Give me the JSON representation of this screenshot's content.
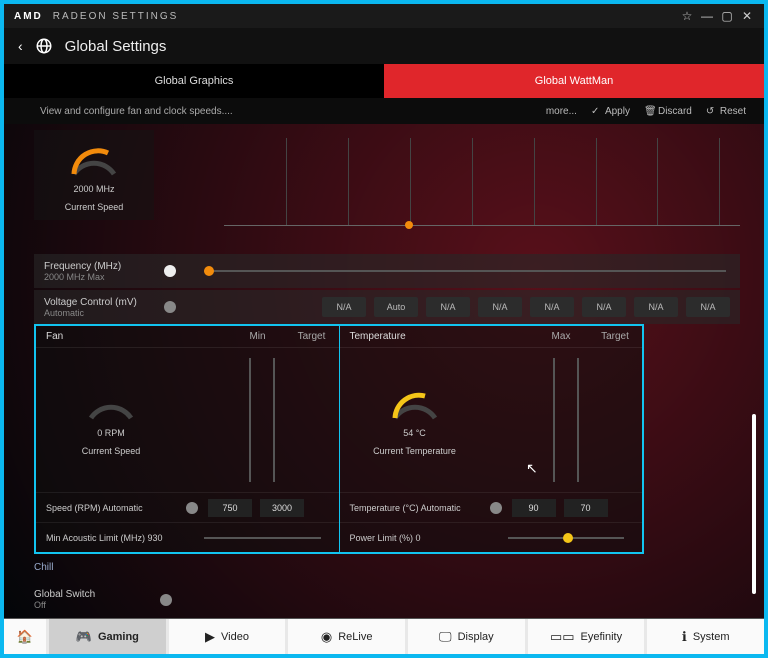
{
  "titlebar": {
    "brand": "AMD",
    "title": "RADEON SETTINGS"
  },
  "header": {
    "title": "Global Settings"
  },
  "tabs": {
    "graphics": "Global Graphics",
    "wattman": "Global WattMan"
  },
  "actions": {
    "desc": "View and configure fan and clock speeds....",
    "more": "more...",
    "apply": "Apply",
    "discard": "Discard",
    "reset": "Reset"
  },
  "gpu": {
    "speed_value": "2000 MHz",
    "speed_label": "Current Speed",
    "freq_label": "Frequency (MHz)",
    "freq_sub": "2000 MHz Max",
    "volt_label": "Voltage Control (mV)",
    "volt_sub": "Automatic",
    "volt_opts": [
      "N/A",
      "Auto",
      "N/A",
      "N/A",
      "N/A",
      "N/A",
      "N/A",
      "N/A"
    ]
  },
  "fan": {
    "title": "Fan",
    "min": "Min",
    "target": "Target",
    "value": "0 RPM",
    "label": "Current Speed",
    "speed_row": "Speed (RPM)",
    "speed_sub": "Automatic",
    "boxes": [
      "750",
      "3000"
    ],
    "acoustic_row": "Min Acoustic Limit (MHz)",
    "acoustic_val": "930"
  },
  "temp": {
    "title": "Temperature",
    "max": "Max",
    "target": "Target",
    "value": "54 °C",
    "label": "Current Temperature",
    "temp_row": "Temperature (°C)",
    "temp_sub": "Automatic",
    "boxes": [
      "90",
      "70"
    ],
    "power_row": "Power Limit (%)",
    "power_val": "0"
  },
  "chill": {
    "title": "Chill",
    "switch": "Global Switch",
    "state": "Off"
  },
  "nav": {
    "home": "⌂",
    "gaming": "Gaming",
    "video": "Video",
    "relive": "ReLive",
    "display": "Display",
    "eyefinity": "Eyefinity",
    "system": "System"
  }
}
